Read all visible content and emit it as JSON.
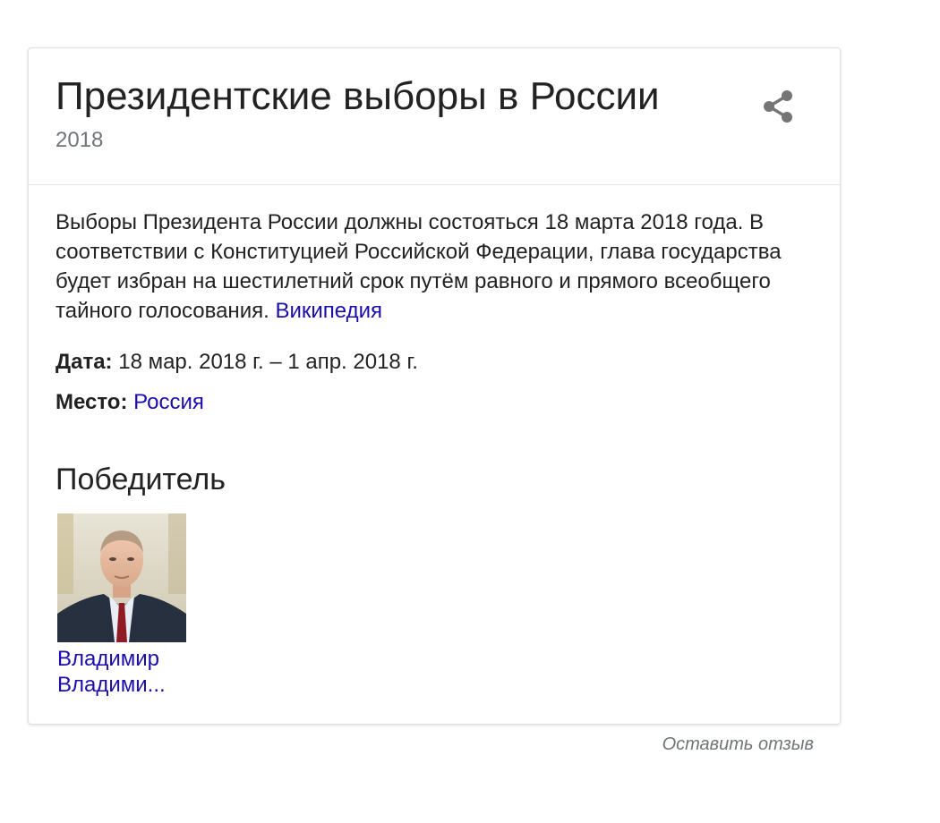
{
  "card": {
    "title": "Президентские выборы в России",
    "subtitle": "2018",
    "share_icon": "share-icon",
    "description": {
      "text": "Выборы Президента России должны состояться 18 марта 2018 года. В соответствии с Конституцией Российской Федерации, глава государства будет избран на шестилетний срок путём равного и прямого всеобщего тайного голосования.",
      "source_link": "Википедия"
    },
    "facts": {
      "date_label": "Дата:",
      "date_value": "18 мар. 2018 г. – 1 апр. 2018 г.",
      "place_label": "Место:",
      "place_value": "Россия"
    },
    "winner": {
      "section_title": "Победитель",
      "name_line1": "Владимир",
      "name_line2": "Владими..."
    }
  },
  "feedback": {
    "label": "Оставить отзыв"
  },
  "colors": {
    "link": "#1a0dab",
    "text": "#222222",
    "secondary_text": "#70757a",
    "icon": "#757575",
    "border": "#dfe1e5"
  }
}
